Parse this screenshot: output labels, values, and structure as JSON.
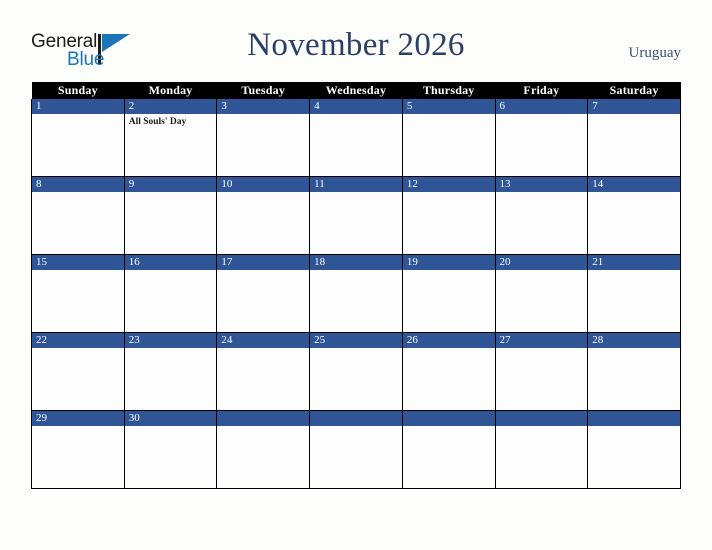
{
  "brand": {
    "name_top": "General",
    "name_bottom": "Blue",
    "color_dark": "#1c1c1c",
    "color_blue": "#1b75bb"
  },
  "header": {
    "title": "November 2026",
    "country": "Uruguay",
    "title_color": "#2b3f66"
  },
  "colors": {
    "header_row_bg": "#000000",
    "day_number_bg": "#2f5597",
    "cell_bg": "#fdfdfd",
    "page_bg": "#fdfdfb",
    "border": "#000000"
  },
  "calendar": {
    "weekday_headers": [
      "Sunday",
      "Monday",
      "Tuesday",
      "Wednesday",
      "Thursday",
      "Friday",
      "Saturday"
    ],
    "weeks": [
      [
        {
          "day": "1",
          "events": []
        },
        {
          "day": "2",
          "events": [
            "All Souls' Day"
          ]
        },
        {
          "day": "3",
          "events": []
        },
        {
          "day": "4",
          "events": []
        },
        {
          "day": "5",
          "events": []
        },
        {
          "day": "6",
          "events": []
        },
        {
          "day": "7",
          "events": []
        }
      ],
      [
        {
          "day": "8",
          "events": []
        },
        {
          "day": "9",
          "events": []
        },
        {
          "day": "10",
          "events": []
        },
        {
          "day": "11",
          "events": []
        },
        {
          "day": "12",
          "events": []
        },
        {
          "day": "13",
          "events": []
        },
        {
          "day": "14",
          "events": []
        }
      ],
      [
        {
          "day": "15",
          "events": []
        },
        {
          "day": "16",
          "events": []
        },
        {
          "day": "17",
          "events": []
        },
        {
          "day": "18",
          "events": []
        },
        {
          "day": "19",
          "events": []
        },
        {
          "day": "20",
          "events": []
        },
        {
          "day": "21",
          "events": []
        }
      ],
      [
        {
          "day": "22",
          "events": []
        },
        {
          "day": "23",
          "events": []
        },
        {
          "day": "24",
          "events": []
        },
        {
          "day": "25",
          "events": []
        },
        {
          "day": "26",
          "events": []
        },
        {
          "day": "27",
          "events": []
        },
        {
          "day": "28",
          "events": []
        }
      ],
      [
        {
          "day": "29",
          "events": []
        },
        {
          "day": "30",
          "events": []
        },
        {
          "day": "",
          "events": []
        },
        {
          "day": "",
          "events": []
        },
        {
          "day": "",
          "events": []
        },
        {
          "day": "",
          "events": []
        },
        {
          "day": "",
          "events": []
        }
      ]
    ]
  }
}
